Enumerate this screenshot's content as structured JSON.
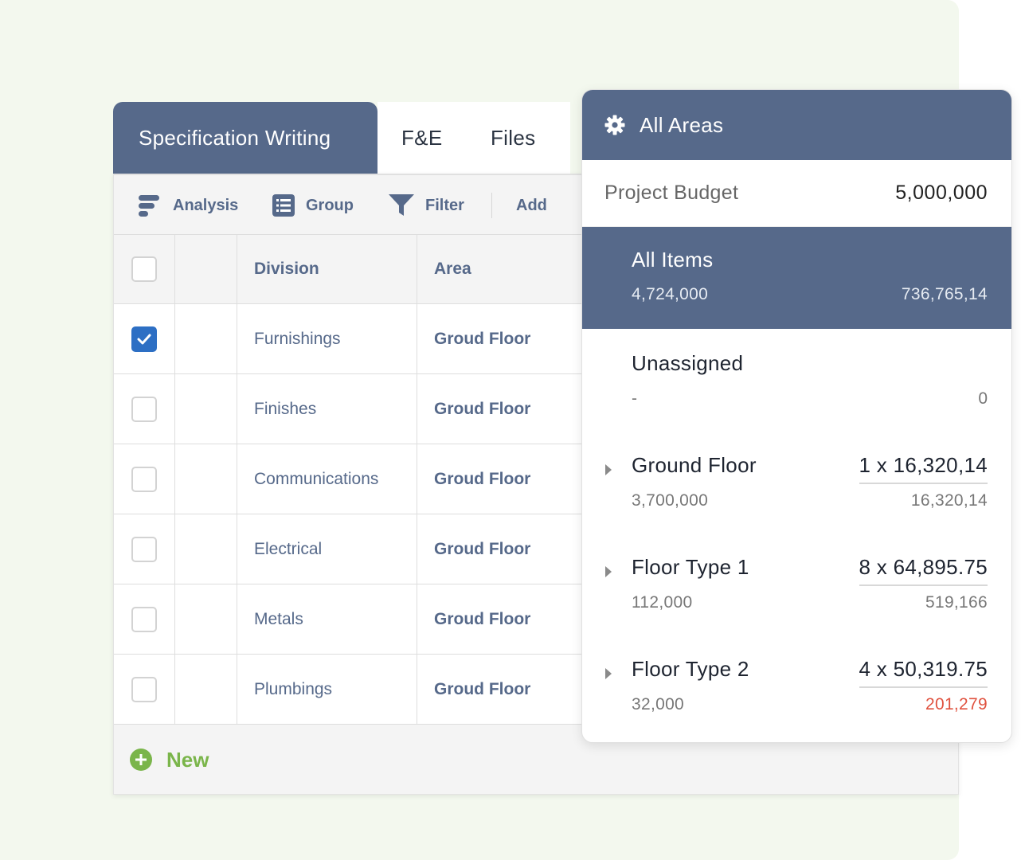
{
  "tabs": [
    {
      "label": "Specification Writing",
      "active": true
    },
    {
      "label": "F&E",
      "active": false
    },
    {
      "label": "Files",
      "active": false
    }
  ],
  "toolbar": {
    "analysis_label": "Analysis",
    "group_label": "Group",
    "filter_label": "Filter",
    "add_label": "Add"
  },
  "table": {
    "headers": {
      "division": "Division",
      "area": "Area"
    },
    "rows": [
      {
        "division": "Furnishings",
        "area": "Groud Floor",
        "checked": true
      },
      {
        "division": "Finishes",
        "area": "Groud Floor",
        "checked": false
      },
      {
        "division": "Communications",
        "area": "Groud Floor",
        "checked": false
      },
      {
        "division": "Electrical",
        "area": "Groud Floor",
        "checked": false
      },
      {
        "division": "Metals",
        "area": "Groud Floor",
        "checked": false
      },
      {
        "division": "Plumbings",
        "area": "Groud Floor",
        "checked": false
      }
    ],
    "new_label": "New"
  },
  "panel": {
    "title": "All Areas",
    "budget_label": "Project Budget",
    "budget_value": "5,000,000",
    "all_items": {
      "name": "All Items",
      "sub": "4,724,000",
      "right": "736,765,14"
    },
    "unassigned": {
      "name": "Unassigned",
      "sub": "-",
      "right": "0"
    },
    "areas": [
      {
        "name": "Ground Floor",
        "sub": "3,700,000",
        "mult": "1 x 16,320,14",
        "total": "16,320,14",
        "over": false
      },
      {
        "name": "Floor Type 1",
        "sub": "112,000",
        "mult": "8 x 64,895.75",
        "total": "519,166",
        "over": false
      },
      {
        "name": "Floor Type 2",
        "sub": "32,000",
        "mult": "4 x 50,319.75",
        "total": "201,279",
        "over": true
      }
    ]
  },
  "colors": {
    "accent": "#56698a",
    "check": "#2d6fc4",
    "new": "#7ab54a",
    "negative": "#e0523f",
    "background": "#f3f8ee"
  }
}
